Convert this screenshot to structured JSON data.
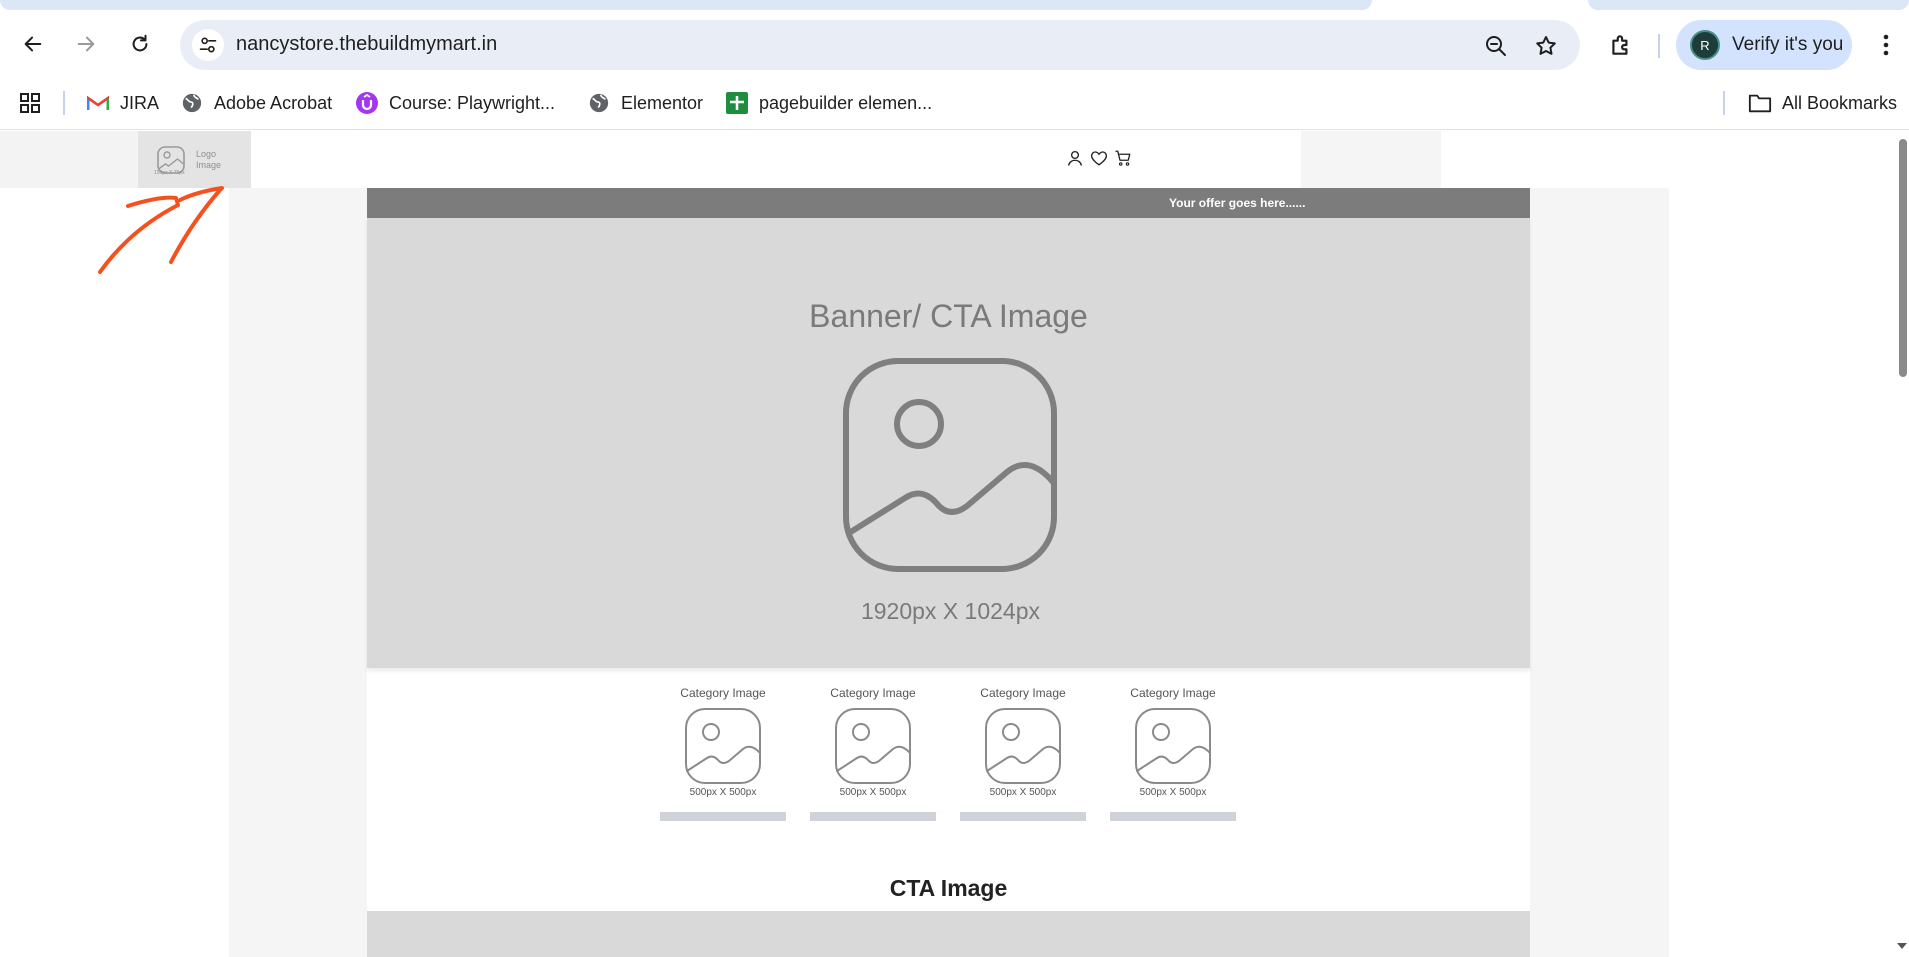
{
  "browser": {
    "url": "nancystore.thebuildmymart.in",
    "profile_initial": "R",
    "profile_label": "Verify it's you",
    "bookmarks": [
      {
        "label": "JIRA",
        "icon": "gmail-icon"
      },
      {
        "label": "Adobe Acrobat",
        "icon": "globe-icon"
      },
      {
        "label": "Course: Playwright...",
        "icon": "udemy-icon"
      },
      {
        "label": "Elementor",
        "icon": "globe-icon"
      },
      {
        "label": "pagebuilder elemen...",
        "icon": "sheets-icon"
      }
    ],
    "all_bookmarks_label": "All Bookmarks",
    "colors": {
      "omnibox": "#e9eef6",
      "profile_chip": "#d3e3fd"
    }
  },
  "page": {
    "header": {
      "logo_text_line1": "Logo",
      "logo_text_line2": "Image",
      "logo_size": "150px X 75px",
      "icons": [
        "user-icon",
        "heart-icon",
        "cart-icon"
      ]
    },
    "offer_text": "Your offer goes here......",
    "banner": {
      "title": "Banner/ CTA Image",
      "dimensions": "1920px X 1024px"
    },
    "categories": [
      {
        "title": "Category Image",
        "dimensions": "500px X 500px"
      },
      {
        "title": "Category Image",
        "dimensions": "500px X 500px"
      },
      {
        "title": "Category Image",
        "dimensions": "500px X 500px"
      },
      {
        "title": "Category Image",
        "dimensions": "500px X 500px"
      }
    ],
    "cta_title": "CTA Image",
    "colors": {
      "offer_bar": "#7c7c7c",
      "placeholder": "#d9d9d9",
      "annotation_arrow": "#f4511e"
    }
  }
}
